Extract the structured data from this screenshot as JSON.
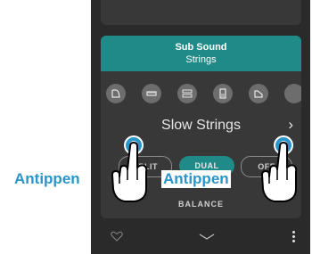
{
  "panel": {
    "title": "Sub Sound",
    "subtitle": "Strings",
    "sound_name": "Slow Strings",
    "icons": [
      "grand-piano-icon",
      "electric-piano-icon",
      "organ-icon",
      "harpsichord-icon",
      "strings-icon"
    ]
  },
  "modes": {
    "split": "SPLIT",
    "dual": "DUAL",
    "off": "OFF",
    "active": "DUAL"
  },
  "balance_label": "BALANCE",
  "annotations": {
    "left": "Antippen",
    "right": "Antippen"
  },
  "colors": {
    "accent": "#1f8a87",
    "annotation": "#2a95c8",
    "panel": "#383838"
  }
}
